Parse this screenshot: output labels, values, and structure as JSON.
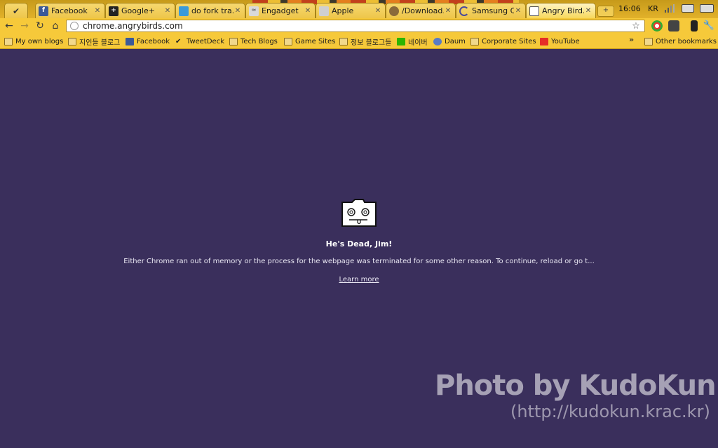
{
  "tabs": [
    {
      "title": "Facebook",
      "icon": "facebook-icon",
      "color": "#3b5998",
      "glyph": "f"
    },
    {
      "title": "Google+",
      "icon": "google-plus-icon",
      "color": "#222222",
      "glyph": "+"
    },
    {
      "title": "do fork tra...",
      "icon": "page-icon",
      "color": "#3b9ad9",
      "glyph": ""
    },
    {
      "title": "Engadget",
      "icon": "rss-icon",
      "color": "#d9d9d9",
      "glyph": ""
    },
    {
      "title": "Apple",
      "icon": "apple-icon",
      "color": "#cfcfcf",
      "glyph": ""
    },
    {
      "title": "/Download...",
      "icon": "download-site-icon",
      "color": "#8a6a3a",
      "glyph": ""
    },
    {
      "title": "Samsung C...",
      "icon": "loading-icon",
      "color": "#4a4a9a",
      "glyph": ""
    },
    {
      "title": "Angry Bird...",
      "icon": "sad-tab-icon",
      "color": "#ffffff",
      "glyph": ""
    }
  ],
  "system_tray": {
    "time": "16:06",
    "locale": "KR"
  },
  "omnibox": {
    "url": "chrome.angrybirds.com"
  },
  "bookmarks": [
    {
      "label": "My own blogs",
      "icon": "folder-icon"
    },
    {
      "label": "지인들 블로그",
      "icon": "folder-icon"
    },
    {
      "label": "Facebook",
      "icon": "facebook-icon"
    },
    {
      "label": "TweetDeck",
      "icon": "tweetdeck-icon"
    },
    {
      "label": "Tech Blogs",
      "icon": "folder-icon"
    },
    {
      "label": "Game Sites",
      "icon": "folder-icon"
    },
    {
      "label": "정보 블로그들",
      "icon": "folder-icon"
    },
    {
      "label": "네이버",
      "icon": "naver-icon"
    },
    {
      "label": "Daum",
      "icon": "daum-icon"
    },
    {
      "label": "Corporate Sites",
      "icon": "folder-icon"
    },
    {
      "label": "YouTube",
      "icon": "youtube-icon"
    }
  ],
  "other_bookmarks": "Other bookmarks",
  "error": {
    "title": "He's Dead, Jim!",
    "message": "Either Chrome ran out of memory or the process for the webpage was terminated for some other reason.  To continue, reload or go t...",
    "learn_more": "Learn more"
  },
  "watermark": {
    "line1": "Photo by KudoKun.",
    "line2": "(http://kudokun.krac.kr)"
  },
  "colors": {
    "page_bg": "#3a2f5c",
    "toolbar": "#f6c93a"
  }
}
